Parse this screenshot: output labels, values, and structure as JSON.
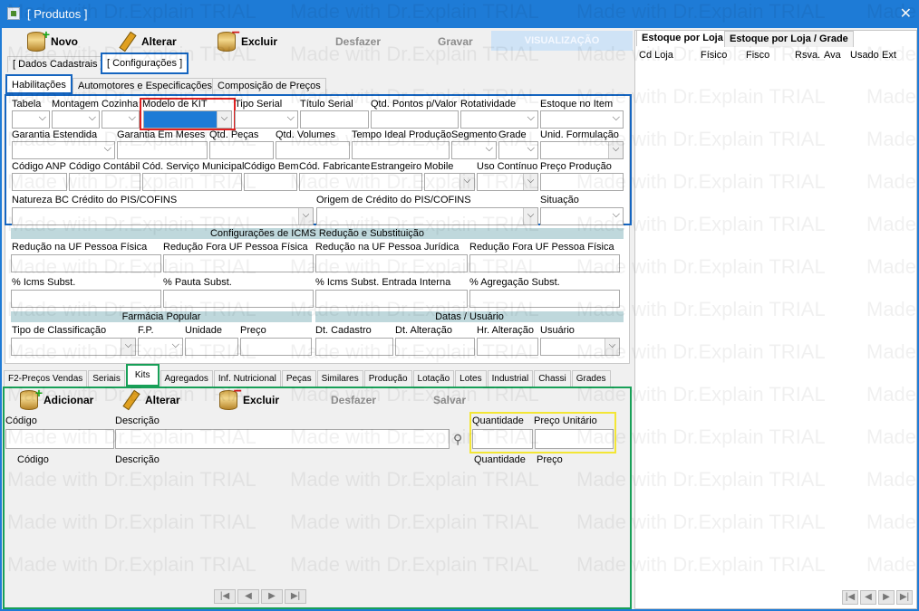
{
  "window": {
    "title": "[ Produtos ]"
  },
  "toolbar": {
    "novo": "Novo",
    "alterar": "Alterar",
    "excluir": "Excluir",
    "desfazer": "Desfazer",
    "gravar": "Gravar",
    "visualizacao": "VISUALIZAÇÃO"
  },
  "main_tabs": {
    "dados": "[ Dados Cadastrais ]",
    "config": "[ Configurações ]"
  },
  "sub_tabs": {
    "habilitacoes": "Habilitações",
    "automotores": "Automotores e Especificações",
    "composicao": "Composição de Preços"
  },
  "labels": {
    "tabela": "Tabela",
    "montagem": "Montagem",
    "cozinha": "Cozinha",
    "modelo_kit": "Modelo de KIT",
    "tipo_serial": "Tipo Serial",
    "titulo_serial": "Título Serial",
    "qtd_pontos": "Qtd. Pontos p/Valor",
    "rotatividade": "Rotatividade",
    "estoque_item": "Estoque no Item",
    "garantia_estendida": "Garantia Estendida",
    "garantia_meses": "Garantia Em Meses",
    "qtd_pecas": "Qtd. Peças",
    "qtd_volumes": "Qtd. Volumes",
    "tempo_ideal": "Tempo Ideal Produção",
    "segmento": "Segmento",
    "grade": "Grade",
    "unid_formulacao": "Unid. Formulação",
    "codigo_anp": "Código ANP",
    "codigo_contabil": "Código Contábil",
    "cod_servico": "Cód. Serviço Municipal",
    "codigo_bem": "Código Bem",
    "cod_fabricante": "Cód. Fabricante",
    "estrangeiro": "Estrangeiro",
    "mobile": "Mobile",
    "uso_continuo": "Uso Contínuo",
    "preco_producao": "Preço Produção",
    "natureza_bc": "Natureza BC Crédito do PIS/COFINS",
    "origem_credito": "Origem de Crédito do PIS/COFINS",
    "situacao": "Situação",
    "icms_section": "Configurações de ICMS Redução e Substituição",
    "red_uf_pf": "Redução na UF Pessoa Física",
    "red_fora_pf": "Redução Fora UF Pessoa Física",
    "red_uf_pj": "Redução na UF Pessoa Jurídica",
    "red_fora_pj": "Redução Fora UF Pessoa Física",
    "icms_subst": "% Icms Subst.",
    "pauta_subst": "% Pauta Subst.",
    "icms_entrada": "% Icms Subst. Entrada Interna",
    "agregacao": "% Agregação Subst.",
    "farmacia_section": "Farmácia Popular",
    "datas_section": "Datas / Usuário",
    "tipo_classificacao": "Tipo de Classificação",
    "fp": "F.P.",
    "unidade": "Unidade",
    "preco": "Preço",
    "dt_cadastro": "Dt. Cadastro",
    "dt_alteracao": "Dt. Alteração",
    "hr_alteracao": "Hr. Alteração",
    "usuario": "Usuário"
  },
  "bottom_tabs": [
    "F2-Preços Vendas",
    "Seriais",
    "Kits",
    "Agregados",
    "Inf. Nutricional",
    "Peças",
    "Similares",
    "Produção",
    "Lotação",
    "Lotes",
    "Industrial",
    "Chassi",
    "Grades"
  ],
  "kits": {
    "adicionar": "Adicionar",
    "alterar": "Alterar",
    "excluir": "Excluir",
    "desfazer": "Desfazer",
    "salvar": "Salvar",
    "codigo": "Código",
    "descricao": "Descrição",
    "quantidade": "Quantidade",
    "preco_unitario": "Preço Unitário",
    "grid_codigo": "Código",
    "grid_descricao": "Descrição",
    "grid_quantidade": "Quantidade",
    "grid_preco": "Preço"
  },
  "estoque": {
    "tab_loja": "Estoque por Loja",
    "tab_grade": "Estoque por Loja / Grade",
    "columns": [
      "Cd Loja",
      "Físico",
      "Fisco",
      "Rsva.",
      "Ava",
      "Usado",
      "Ext"
    ]
  },
  "nav": {
    "first": "|◀",
    "prev": "◀",
    "next": "▶",
    "last": "▶|"
  },
  "watermark": "Made with Dr.Explain TRIAL"
}
